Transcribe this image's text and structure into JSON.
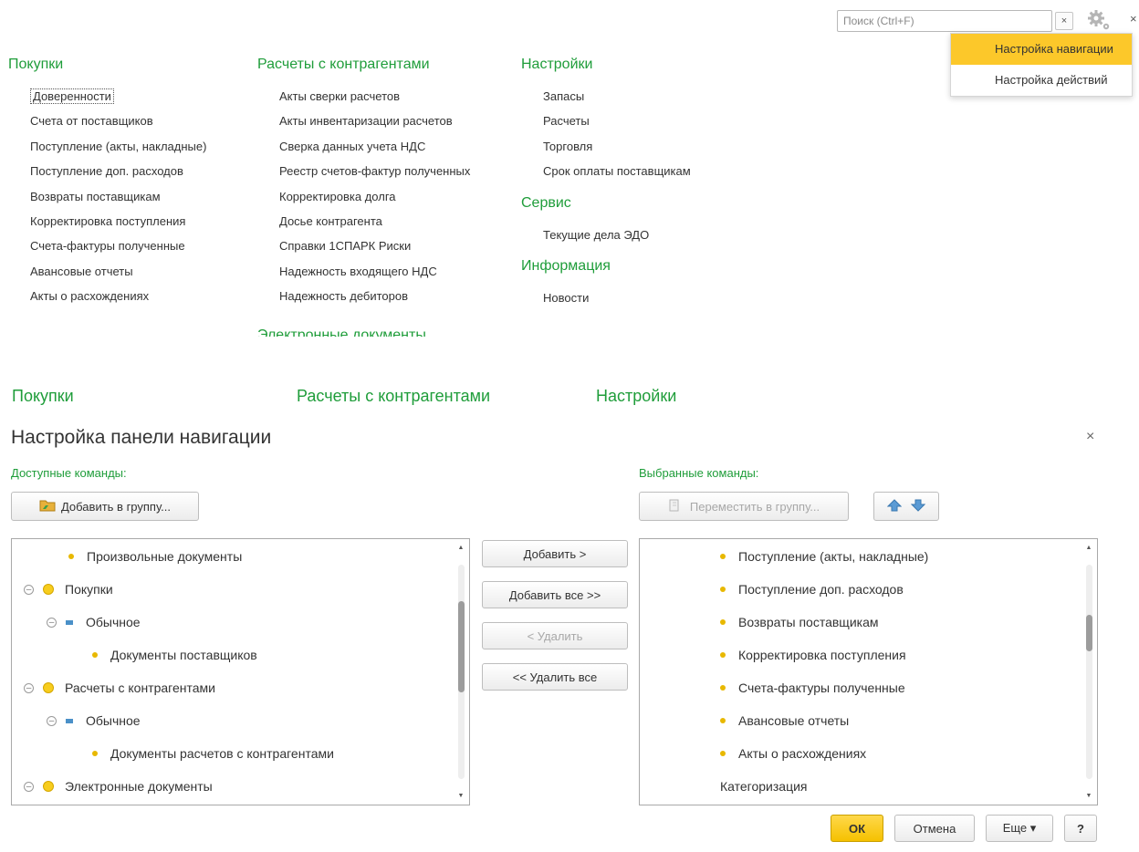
{
  "top": {
    "search": {
      "placeholder": "Поиск (Ctrl+F)",
      "clear": "×"
    },
    "close": "×",
    "menu": [
      "Настройка навигации",
      "Настройка действий"
    ],
    "col1": {
      "title": "Покупки",
      "items": [
        "Доверенности",
        "Счета от поставщиков",
        "Поступление (акты, накладные)",
        "Поступление доп. расходов",
        "Возвраты поставщикам",
        "Корректировка поступления",
        "Счета-фактуры полученные",
        "Авансовые отчеты",
        "Акты о расхождениях"
      ]
    },
    "col2": {
      "title": "Расчеты с контрагентами",
      "items": [
        "Акты сверки расчетов",
        "Акты инвентаризации расчетов",
        "Сверка данных учета НДС",
        "Реестр счетов-фактур полученных",
        "Корректировка долга",
        "Досье контрагента",
        "Справки 1СПАРК Риски",
        "Надежность входящего НДС",
        "Надежность дебиторов"
      ],
      "clipped": "Электронные документы"
    },
    "col3": {
      "sections": [
        {
          "title": "Настройки",
          "items": [
            "Запасы",
            "Расчеты",
            "Торговля",
            "Срок оплаты поставщикам"
          ]
        },
        {
          "title": "Сервис",
          "items": [
            "Текущие дела ЭДО"
          ]
        },
        {
          "title": "Информация",
          "items": [
            "Новости"
          ]
        }
      ]
    }
  },
  "background_headers": [
    "Покупки",
    "Расчеты с контрагентами",
    "Настройки"
  ],
  "dialog": {
    "title": "Настройка панели навигации",
    "close": "×",
    "left_label": "Доступные команды:",
    "right_label": "Выбранные команды:",
    "add_to_group": "Добавить в группу...",
    "move_to_group": "Переместить в группу...",
    "left_items": [
      {
        "text": "Произвольные документы",
        "level": 2,
        "kind": "dot"
      },
      {
        "text": "Покупки",
        "level": 0,
        "kind": "group"
      },
      {
        "text": "Обычное",
        "level": 1,
        "kind": "sub"
      },
      {
        "text": "Документы поставщиков",
        "level": 2,
        "kind": "dot"
      },
      {
        "text": "Расчеты с контрагентами",
        "level": 0,
        "kind": "group"
      },
      {
        "text": "Обычное",
        "level": 1,
        "kind": "sub"
      },
      {
        "text": "Документы расчетов с контрагентами",
        "level": 2,
        "kind": "dot"
      },
      {
        "text": "Электронные документы",
        "level": 0,
        "kind": "group"
      }
    ],
    "right_items": [
      {
        "text": "Поступление (акты, накладные)",
        "kind": "dot"
      },
      {
        "text": "Поступление доп. расходов",
        "kind": "dot"
      },
      {
        "text": "Возвраты поставщикам",
        "kind": "dot"
      },
      {
        "text": "Корректировка поступления",
        "kind": "dot"
      },
      {
        "text": "Счета-фактуры полученные",
        "kind": "dot"
      },
      {
        "text": "Авансовые отчеты",
        "kind": "dot"
      },
      {
        "text": "Акты о расхождениях",
        "kind": "dot"
      },
      {
        "text": "Категоризация",
        "kind": "plain"
      }
    ],
    "mid_buttons": {
      "add": "Добавить >",
      "add_all": "Добавить все >>",
      "remove": "< Удалить",
      "remove_all": "<< Удалить все"
    },
    "footer": {
      "ok": "ОК",
      "cancel": "Отмена",
      "more": "Еще ▾",
      "help": "?"
    }
  },
  "colors": {
    "accent_green": "#1f9d3a",
    "highlight_yellow": "#fcc82a"
  }
}
